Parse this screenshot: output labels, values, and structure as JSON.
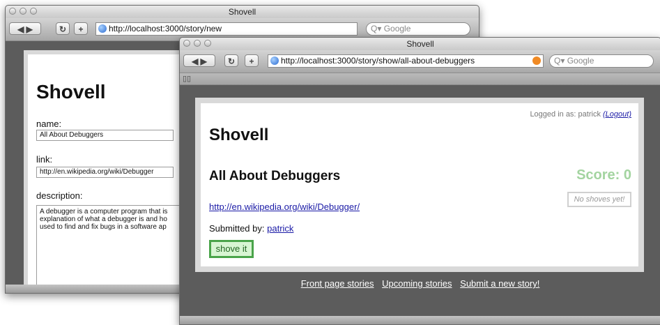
{
  "back_window": {
    "title": "Shovell",
    "url": "http://localhost:3000/story/new",
    "search_placeholder": "Q▾ Google",
    "app_title": "Shovell",
    "form": {
      "name_label": "name:",
      "name_value": "All About Debuggers",
      "link_label": "link:",
      "link_value": "http://en.wikipedia.org/wiki/Debugger",
      "description_label": "description:",
      "description_lines": [
        "A debugger is a computer program that is",
        "explanation of what a debugger is and ho",
        "used to find and fix bugs in a software ap"
      ]
    }
  },
  "front_window": {
    "title": "Shovell",
    "url": "http://localhost:3000/story/show/all-about-debuggers",
    "search_placeholder": "Q▾ Google",
    "login_text": "Logged in as: patrick",
    "logout_label": "(Logout)",
    "app_title": "Shovell",
    "story": {
      "title": "All About Debuggers",
      "score": "Score: 0",
      "no_shoves": "No shoves yet!",
      "link": "http://en.wikipedia.org/wiki/Debugger/",
      "submitted_by_label": "Submitted by:",
      "submitted_by_user": "patrick",
      "shove_button": "shove it"
    },
    "footer_links": [
      "Front page stories",
      "Upcoming stories",
      "Submit a new story!"
    ]
  }
}
